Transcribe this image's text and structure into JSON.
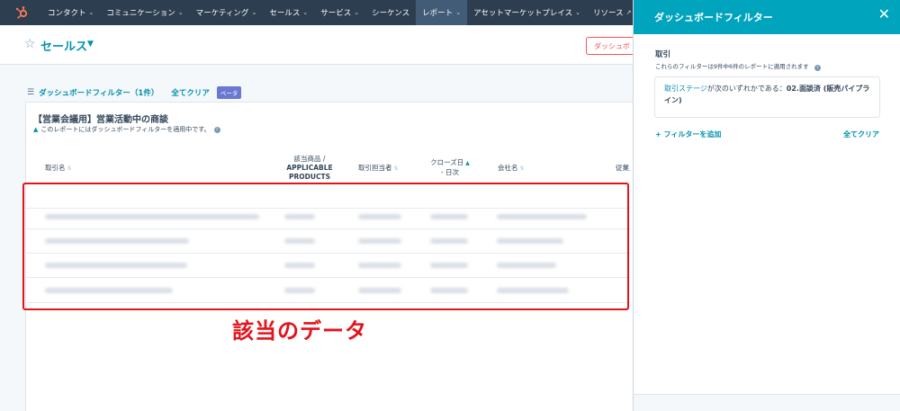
{
  "nav": {
    "items": [
      {
        "label": "コンタクト",
        "chevron": true
      },
      {
        "label": "コミュニケーション",
        "chevron": true
      },
      {
        "label": "マーケティング",
        "chevron": true
      },
      {
        "label": "セールス",
        "chevron": true
      },
      {
        "label": "サービス",
        "chevron": true
      },
      {
        "label": "シーケンス",
        "chevron": false
      },
      {
        "label": "レポート",
        "chevron": true
      },
      {
        "label": "アセットマーケットプレイス",
        "chevron": true
      },
      {
        "label": "リソース",
        "chevron": false
      }
    ],
    "active_index": 6,
    "colors": {
      "bar": "#2d3e50",
      "active": "#425b76",
      "logo": "#ff7a59"
    }
  },
  "header": {
    "dashboard_name": "セールス",
    "dashboard_button": "ダッシュボ"
  },
  "filter_bar": {
    "label": "ダッシュボードフィルター（1件）",
    "clear_label": "全てクリア",
    "beta_label": "ベータ"
  },
  "report": {
    "title": "【営業会議用】営業活動中の商談",
    "note": "このレポートにはダッシュボードフィルターを適用中です。",
    "columns": {
      "deal_name": "取引名",
      "product_line1": "該当商品 /",
      "product_line2": "APPLICABLE",
      "product_line3": "PRODUCTS",
      "owner": "取引担当者",
      "close_line1": "クローズ日",
      "close_line2": "- 日次",
      "company": "会社名",
      "employee": "従業員"
    },
    "row_count": 5
  },
  "annotation": {
    "label": "該当のデータ",
    "color": "#e3131c"
  },
  "panel": {
    "title": "ダッシュボードフィルター",
    "section_title": "取引",
    "section_subtitle": "これらのフィルターは9件中6件のレポートに適用されます",
    "filter_property": "取引ステージ",
    "filter_connector": "が次のいずれかである：",
    "filter_value": "02.面談済 (販売パイプライン)",
    "add_filter": "+ フィルターを追加",
    "clear_all": "全てクリア",
    "colors": {
      "header": "#00a4bd",
      "link": "#0091ae"
    }
  }
}
